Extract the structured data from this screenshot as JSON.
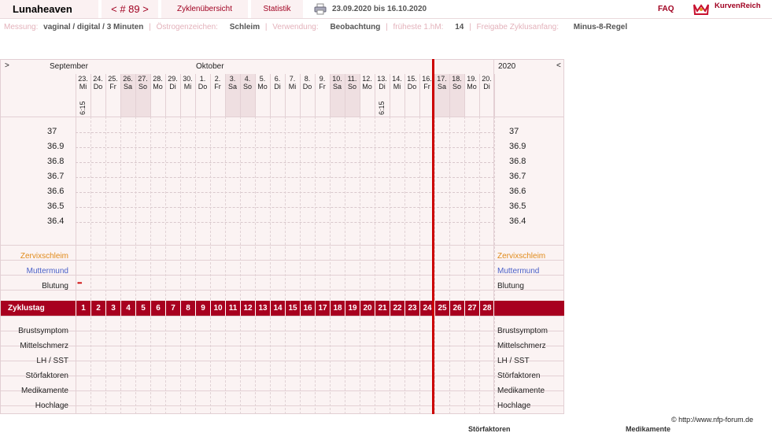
{
  "header": {
    "user": "Lunaheaven",
    "cycle_nav": "< # 89 >",
    "tab_overview": "Zyklenübersicht",
    "tab_stats": "Statistik",
    "date_range": "23.09.2020 bis 16.10.2020",
    "faq": "FAQ",
    "brand": "KurvenReich"
  },
  "info": {
    "messung_label": "Messung:",
    "messung_value": "vaginal / digital / 3 Minuten",
    "oestrogen_label": "Östrogenzeichen:",
    "oestrogen_value": "Schleim",
    "verwendung_label": "Verwendung:",
    "verwendung_value": "Beobachtung",
    "fruehste_label": "früheste 1.hM:",
    "fruehste_value": "14",
    "freigabe_label": "Freigabe Zyklusanfang:",
    "freigabe_value": "Minus-8-Regel"
  },
  "chart": {
    "nav_left": ">",
    "nav_right": "<",
    "month_sep": "September",
    "month_oct": "Oktober",
    "year": "2020",
    "days": [
      {
        "d": "23.",
        "w": "Mi",
        "we": false,
        "time": "6:15"
      },
      {
        "d": "24.",
        "w": "Do",
        "we": false,
        "time": ""
      },
      {
        "d": "25.",
        "w": "Fr",
        "we": false,
        "time": ""
      },
      {
        "d": "26.",
        "w": "Sa",
        "we": true,
        "time": ""
      },
      {
        "d": "27.",
        "w": "So",
        "we": true,
        "time": ""
      },
      {
        "d": "28.",
        "w": "Mo",
        "we": false,
        "time": ""
      },
      {
        "d": "29.",
        "w": "Di",
        "we": false,
        "time": ""
      },
      {
        "d": "30.",
        "w": "Mi",
        "we": false,
        "time": ""
      },
      {
        "d": "1.",
        "w": "Do",
        "we": false,
        "time": ""
      },
      {
        "d": "2.",
        "w": "Fr",
        "we": false,
        "time": ""
      },
      {
        "d": "3.",
        "w": "Sa",
        "we": true,
        "time": ""
      },
      {
        "d": "4.",
        "w": "So",
        "we": true,
        "time": ""
      },
      {
        "d": "5.",
        "w": "Mo",
        "we": false,
        "time": ""
      },
      {
        "d": "6.",
        "w": "Di",
        "we": false,
        "time": ""
      },
      {
        "d": "7.",
        "w": "Mi",
        "we": false,
        "time": ""
      },
      {
        "d": "8.",
        "w": "Do",
        "we": false,
        "time": ""
      },
      {
        "d": "9.",
        "w": "Fr",
        "we": false,
        "time": ""
      },
      {
        "d": "10.",
        "w": "Sa",
        "we": true,
        "time": ""
      },
      {
        "d": "11.",
        "w": "So",
        "we": true,
        "time": ""
      },
      {
        "d": "12.",
        "w": "Mo",
        "we": false,
        "time": ""
      },
      {
        "d": "13.",
        "w": "Di",
        "we": false,
        "time": "6:15"
      },
      {
        "d": "14.",
        "w": "Mi",
        "we": false,
        "time": ""
      },
      {
        "d": "15.",
        "w": "Do",
        "we": false,
        "time": ""
      },
      {
        "d": "16.",
        "w": "Fr",
        "we": false,
        "time": ""
      },
      {
        "d": "17.",
        "w": "Sa",
        "we": true,
        "time": ""
      },
      {
        "d": "18.",
        "w": "So",
        "we": true,
        "time": ""
      },
      {
        "d": "19.",
        "w": "Mo",
        "we": false,
        "time": ""
      },
      {
        "d": "20.",
        "w": "Di",
        "we": false,
        "time": ""
      }
    ],
    "temps": [
      "37",
      "36.9",
      "36.8",
      "36.7",
      "36.6",
      "36.5",
      "36.4"
    ],
    "obs_rows": [
      {
        "label": "Zervixschleim",
        "color": "#e08a1a"
      },
      {
        "label": "Muttermund",
        "color": "#4a60c8"
      },
      {
        "label": "Blutung",
        "color": "#222222"
      }
    ],
    "bleeding_marker": "•••",
    "zyklustag_label": "Zyklustag",
    "cycle_days": [
      "1",
      "2",
      "3",
      "4",
      "5",
      "6",
      "7",
      "8",
      "9",
      "10",
      "11",
      "12",
      "13",
      "14",
      "15",
      "16",
      "17",
      "18",
      "19",
      "20",
      "21",
      "22",
      "23",
      "24",
      "25",
      "26",
      "27",
      "28"
    ],
    "bottom_rows": [
      "Brustsymptom",
      "Mittelschmerz",
      "LH / SST",
      "Störfaktoren",
      "Medikamente",
      "Hochlage"
    ]
  },
  "footer": {
    "credit": "© http://www.nfp-forum.de",
    "cut1": "Störfaktoren",
    "cut2": "Medikamente"
  }
}
